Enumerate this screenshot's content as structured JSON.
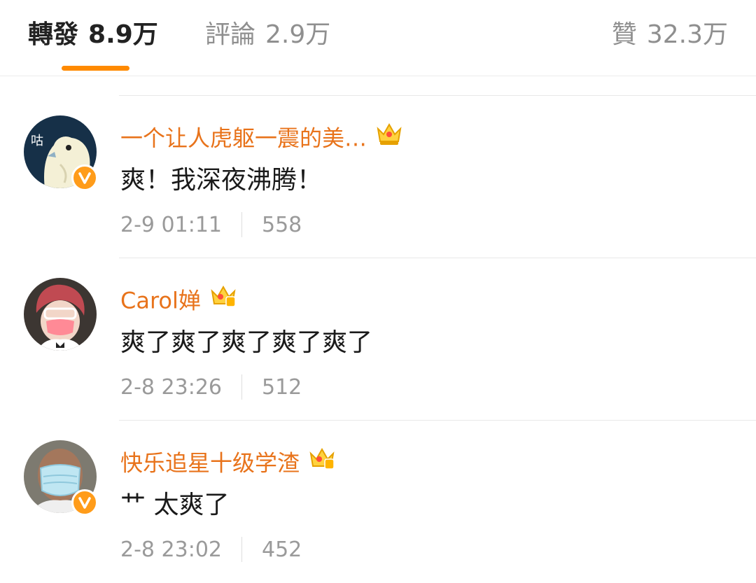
{
  "tabs": [
    {
      "label": "轉發",
      "count": "8.9万"
    },
    {
      "label": "評論",
      "count": "2.9万"
    },
    {
      "label": "贊",
      "count": "32.3万"
    }
  ],
  "accent_color": "#ff8a00",
  "username_color": "#e8731b",
  "comments": [
    {
      "username": "一个让人虎躯一震的美…",
      "text": "爽！我深夜沸腾！",
      "time": "2-9 01:11",
      "likes": "558",
      "avatar_icon": "pigeon-avatar",
      "avatar_glyph": "咕",
      "verified": true
    },
    {
      "username": "Carol婵",
      "text": "爽了爽了爽了爽了爽了",
      "time": "2-8 23:26",
      "likes": "512",
      "avatar_icon": "person-mask-avatar",
      "verified": false
    },
    {
      "username": "快乐追星十级学渣",
      "text": "艹 太爽了",
      "time": "2-8 23:02",
      "likes": "452",
      "avatar_icon": "bald-mask-avatar",
      "verified": true
    }
  ]
}
